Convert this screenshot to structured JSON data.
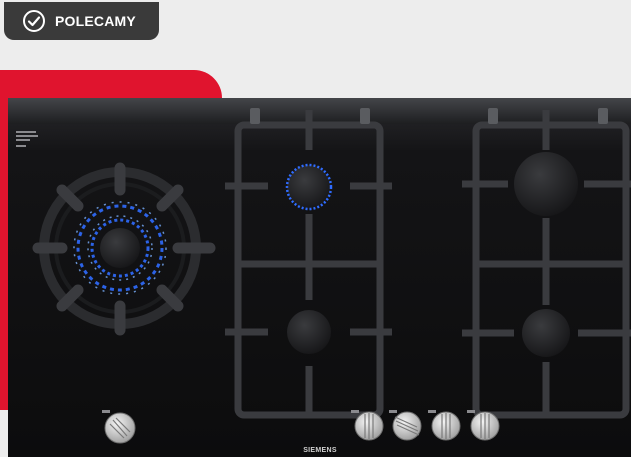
{
  "badge": {
    "label": "POLECAMY",
    "icon": "check-circle-icon"
  },
  "hob": {
    "brand": "SIEMENS",
    "colors": {
      "accent": "#e0142e",
      "glass": "#141416",
      "flame": "#2f6cff"
    }
  }
}
